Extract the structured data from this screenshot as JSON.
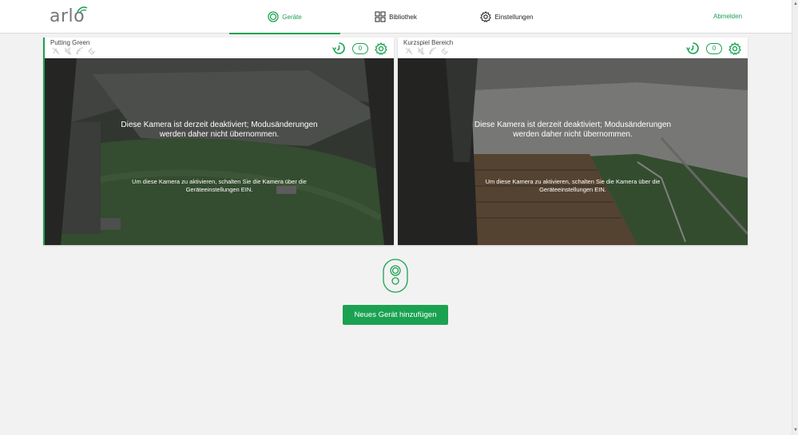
{
  "header": {
    "logo": "arlo",
    "tabs": [
      {
        "label": "Geräte",
        "icon": "device-ring-icon",
        "active": true
      },
      {
        "label": "Bibliothek",
        "icon": "grid-icon",
        "active": false
      },
      {
        "label": "Einstellungen",
        "icon": "gear-icon",
        "active": false
      }
    ],
    "logout_label": "Abmelden"
  },
  "cameras": [
    {
      "name": "Putting Green",
      "counter": "0",
      "message": "Diese Kamera ist derzeit deaktiviert; Modusänderungen werden daher nicht übernommen.",
      "sub_message": "Um diese Kamera zu aktivieren, schalten Sie die Kamera über die Geräteeinstellungen EIN."
    },
    {
      "name": "Kurzspiel Bereich",
      "counter": "0",
      "message": "Diese Kamera ist derzeit deaktiviert; Modusänderungen werden daher nicht übernommen.",
      "sub_message": "Um diese Kamera zu aktivieren, schalten Sie die Kamera über die Geräteeinstellungen EIN."
    }
  ],
  "add_device": {
    "label": "Neues Gerät hinzufügen",
    "icon": "camera-device-icon"
  },
  "colors": {
    "accent": "#1aa251",
    "background": "#f2f2f2"
  }
}
